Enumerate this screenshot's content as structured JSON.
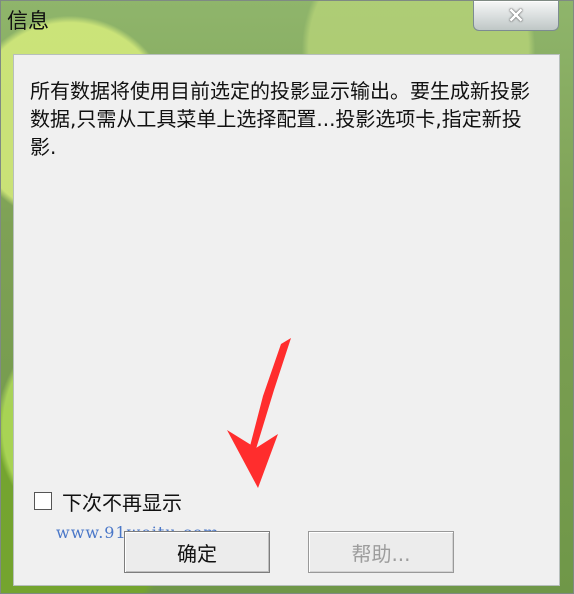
{
  "window": {
    "title": "信息",
    "close_icon": "×"
  },
  "message": {
    "text": "所有数据将使用目前选定的投影显示输出。要生成新投影数据,只需从工具菜单上选择配置...投影选项卡,指定新投影."
  },
  "checkbox": {
    "label": "下次不再显示"
  },
  "watermark": {
    "text": "www.91weitu.com"
  },
  "buttons": {
    "ok": "确定",
    "help": "帮助..."
  },
  "colors": {
    "accent_arrow": "#ff2d2d",
    "watermark": "#4a77c8"
  },
  "icons": {
    "close": "close-icon",
    "arrow": "red-arrow-annotation"
  }
}
